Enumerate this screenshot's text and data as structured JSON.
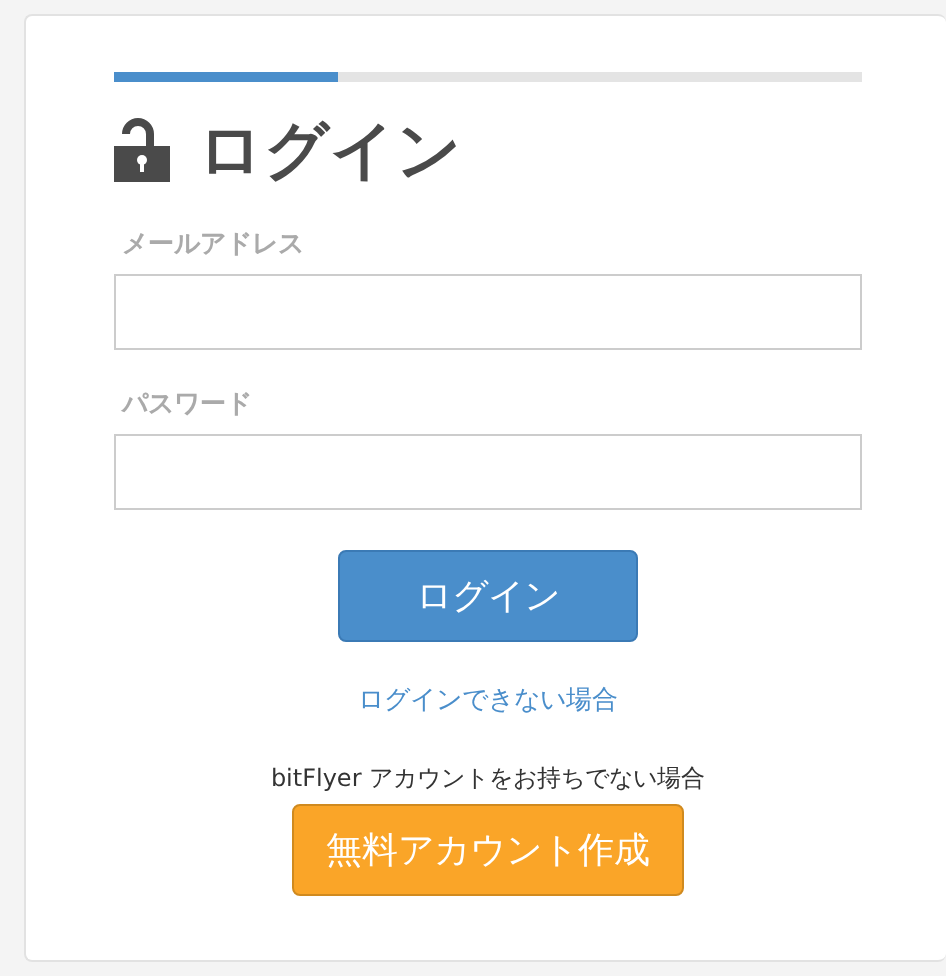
{
  "progress": {
    "level": 0.3
  },
  "title": "ログイン",
  "fields": [
    {
      "label": "メールアドレス"
    },
    {
      "label": "パスワード"
    }
  ],
  "login_button": "ログイン",
  "help_link": "ログインできない場合",
  "signup_prompt": "bitFlyer アカウントをお持ちでない場合",
  "signup_button": "無料アカウント作成"
}
